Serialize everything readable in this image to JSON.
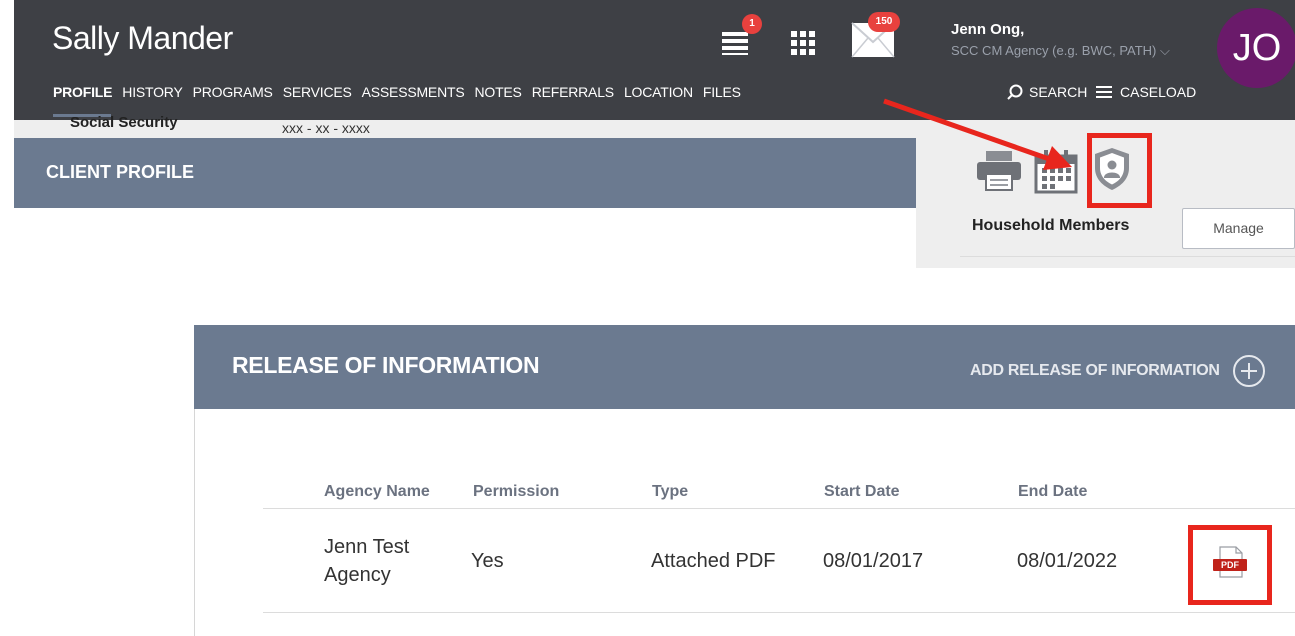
{
  "header": {
    "client_name": "Sally Mander",
    "notifications_badge": "1",
    "messages_badge": "150",
    "user_name": "Jenn Ong,",
    "user_agency": "SCC CM Agency (e.g. BWC, PATH) ⌵",
    "avatar_initials": "JO",
    "search_label": "SEARCH",
    "caseload_label": "CASELOAD"
  },
  "nav": {
    "items": [
      {
        "label": "PROFILE"
      },
      {
        "label": "HISTORY"
      },
      {
        "label": "PROGRAMS"
      },
      {
        "label": "SERVICES"
      },
      {
        "label": "ASSESSMENTS"
      },
      {
        "label": "NOTES"
      },
      {
        "label": "REFERRALS"
      },
      {
        "label": "LOCATION"
      },
      {
        "label": "FILES"
      }
    ]
  },
  "profile": {
    "title": "CLIENT PROFILE",
    "ssn_label": "Social Security",
    "ssn_value": "xxx - xx - xxxx"
  },
  "side_panel": {
    "household_label": "Household Members",
    "manage_label": "Manage"
  },
  "roi": {
    "title": "RELEASE OF INFORMATION",
    "add_label": "ADD RELEASE OF INFORMATION",
    "columns": [
      "Agency Name",
      "Permission",
      "Type",
      "Start Date",
      "End Date"
    ],
    "row": {
      "agency_line1": "Jenn Test",
      "agency_line2": "Agency",
      "permission": "Yes",
      "type": "Attached PDF",
      "start_date": "08/01/2017",
      "end_date": "08/01/2022",
      "pdf_label": "PDF"
    }
  },
  "colors": {
    "header_bg": "#3e4045",
    "panel_header_bg": "#6b7a90",
    "highlight": "#e8261d",
    "badge": "#e8413e",
    "avatar_bg": "#6a1a6a"
  }
}
